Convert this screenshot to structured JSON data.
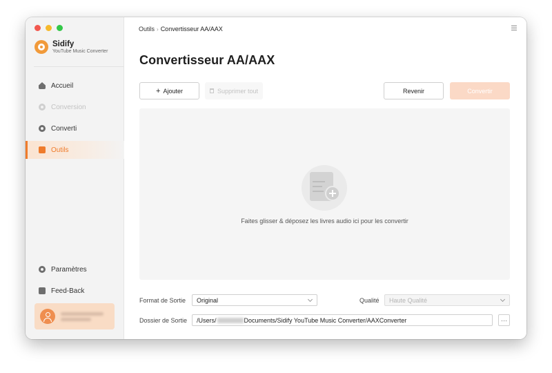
{
  "brand": {
    "name": "Sidify",
    "subtitle": "YouTube Music Converter"
  },
  "sidebar": {
    "items": [
      {
        "label": "Accueil",
        "icon": "home-icon",
        "state": "normal"
      },
      {
        "label": "Conversion",
        "icon": "conversion-icon",
        "state": "disabled"
      },
      {
        "label": "Converti",
        "icon": "clock-icon",
        "state": "normal"
      },
      {
        "label": "Outils",
        "icon": "toolbox-icon",
        "state": "active"
      }
    ],
    "bottom_items": [
      {
        "label": "Paramètres",
        "icon": "gear-icon"
      },
      {
        "label": "Feed-Back",
        "icon": "mail-icon"
      }
    ]
  },
  "breadcrumb": {
    "parent": "Outils",
    "separator": "›",
    "current": "Convertisseur AA/AAX"
  },
  "page": {
    "title": "Convertisseur AA/AAX"
  },
  "toolbar": {
    "add_label": "Ajouter",
    "delete_all_label": "Supprimer tout",
    "back_label": "Revenir",
    "convert_label": "Convertir"
  },
  "dropzone": {
    "text": "Faites glisser & déposez les livres audio ici pour les convertir"
  },
  "settings": {
    "format_label": "Format de Sortie",
    "format_value": "Original",
    "quality_label": "Qualité",
    "quality_value": "Haute Qualité",
    "folder_label": "Dossier de Sortie",
    "folder_prefix": "/Users/",
    "folder_suffix": "Documents/Sidify YouTube Music Converter/AAXConverter",
    "browse_label": "···"
  },
  "colors": {
    "accent": "#ef7b2b",
    "convert_disabled": "#fbd9c6",
    "user_card": "#f9dcc5"
  }
}
